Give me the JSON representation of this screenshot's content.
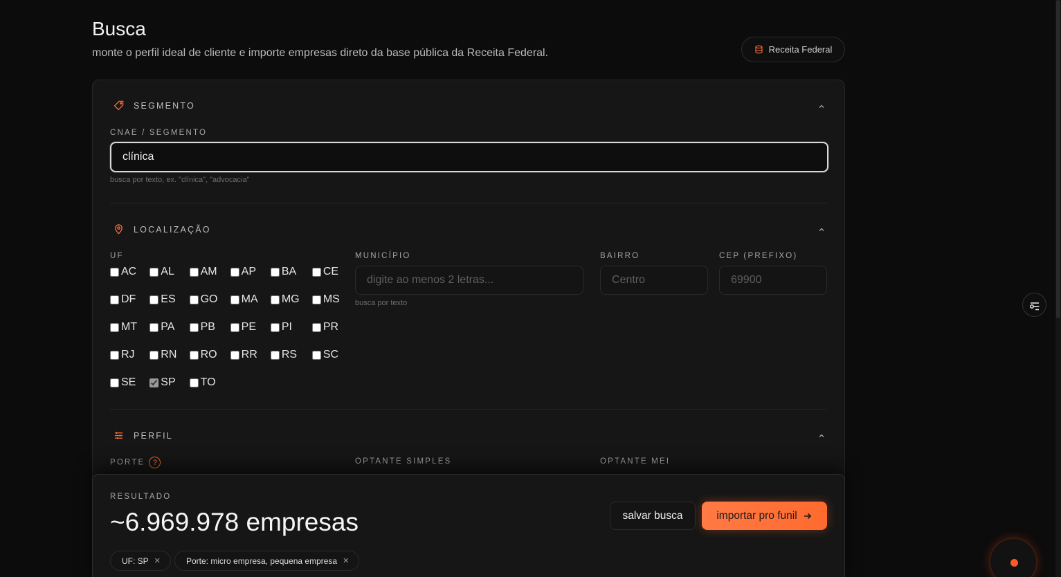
{
  "header": {
    "title": "Busca",
    "subtitle": "monte o perfil ideal de cliente e importe empresas direto da base pública da Receita Federal.",
    "source_label": "Receita Federal"
  },
  "segmento": {
    "section_label": "SEGMENTO",
    "field_label": "CNAE / SEGMENTO",
    "value": "clínica",
    "hint": "busca por texto, ex. \"clínica\", \"advocacia\""
  },
  "localizacao": {
    "section_label": "LOCALIZAÇÃO",
    "uf_label": "UF",
    "ufs": [
      {
        "code": "AC",
        "checked": false
      },
      {
        "code": "AL",
        "checked": false
      },
      {
        "code": "AM",
        "checked": false
      },
      {
        "code": "AP",
        "checked": false
      },
      {
        "code": "BA",
        "checked": false
      },
      {
        "code": "CE",
        "checked": false
      },
      {
        "code": "DF",
        "checked": false
      },
      {
        "code": "ES",
        "checked": false
      },
      {
        "code": "GO",
        "checked": false
      },
      {
        "code": "MA",
        "checked": false
      },
      {
        "code": "MG",
        "checked": false
      },
      {
        "code": "MS",
        "checked": false
      },
      {
        "code": "MT",
        "checked": false
      },
      {
        "code": "PA",
        "checked": false
      },
      {
        "code": "PB",
        "checked": false
      },
      {
        "code": "PE",
        "checked": false
      },
      {
        "code": "PI",
        "checked": false
      },
      {
        "code": "PR",
        "checked": false
      },
      {
        "code": "RJ",
        "checked": false
      },
      {
        "code": "RN",
        "checked": false
      },
      {
        "code": "RO",
        "checked": false
      },
      {
        "code": "RR",
        "checked": false
      },
      {
        "code": "RS",
        "checked": false
      },
      {
        "code": "SC",
        "checked": false
      },
      {
        "code": "SE",
        "checked": false
      },
      {
        "code": "SP",
        "checked": true
      },
      {
        "code": "TO",
        "checked": false
      }
    ],
    "municipio": {
      "label": "MUNICÍPIO",
      "placeholder": "digite ao menos 2 letras...",
      "hint": "busca por texto"
    },
    "bairro": {
      "label": "BAIRRO",
      "placeholder": "Centro"
    },
    "cep": {
      "label": "CEP (PREFIXO)",
      "placeholder": "69900"
    }
  },
  "perfil": {
    "section_label": "PERFIL",
    "porte_label": "PORTE",
    "help_glyph": "?",
    "optante_simples_label": "OPTANTE SIMPLES",
    "optante_mei_label": "OPTANTE MEI"
  },
  "resultado": {
    "label": "RESULTADO",
    "count": "~6.969.978 empresas",
    "save_label": "salvar busca",
    "import_label": "importar pro funil",
    "chips": [
      {
        "label": "UF: SP"
      },
      {
        "label": "Porte: micro empresa, pequena empresa"
      }
    ]
  },
  "colors": {
    "accent": "#ff6b35",
    "background": "#0c0c0c",
    "card": "#161616"
  },
  "icons": [
    "database-icon",
    "tag-icon",
    "map-pin-icon",
    "sliders-icon",
    "chevron-up-icon",
    "filter-icon",
    "arrow-right-icon",
    "close-icon"
  ]
}
